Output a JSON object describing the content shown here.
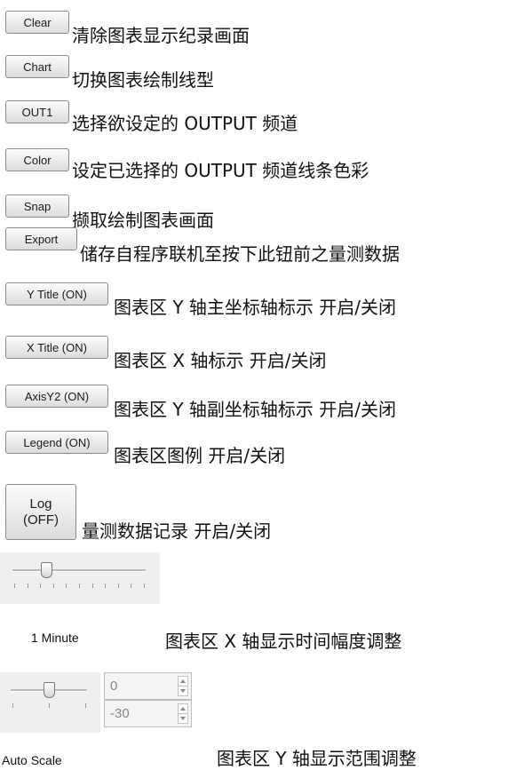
{
  "buttons": {
    "clear": "Clear",
    "chart": "Chart",
    "out1": "OUT1",
    "color": "Color",
    "snap": "Snap",
    "export": "Export",
    "ytitle": "Y Title (ON)",
    "xtitle": "X Title (ON)",
    "axisy2": "AxisY2 (ON)",
    "legend": "Legend (ON)",
    "log_line1": "Log",
    "log_line2": "(OFF)"
  },
  "descriptions": {
    "clear": "清除图表显示纪录画面",
    "chart": "切换图表绘制线型",
    "out1": "选择欲设定的 OUTPUT 频道",
    "color": "设定已选择的 OUTPUT 频道线条色彩",
    "snap": "撷取绘制图表画面",
    "export": "储存自程序联机至按下此钮前之量测数据",
    "ytitle": "图表区 Y 轴主坐标轴标示 开启/关闭",
    "xtitle": "图表区 X 轴标示 开启/关闭",
    "axisy2": "图表区 Y 轴副坐标轴标示 开启/关闭",
    "legend": "图表区图例 开启/关闭",
    "log": "量测数据记录 开启/关闭",
    "xrange": "图表区 X 轴显示时间幅度调整",
    "yrange": "图表区 Y 轴显示范围调整"
  },
  "time_slider": {
    "label": "1 Minute",
    "position": 0.25
  },
  "auto_scale": {
    "label": "Auto Scale",
    "slider_position": 0.5,
    "max_value": "0",
    "min_value": "-30"
  },
  "colors": {
    "button_border": "#8a8a8a",
    "panel_bg": "#efefef"
  }
}
